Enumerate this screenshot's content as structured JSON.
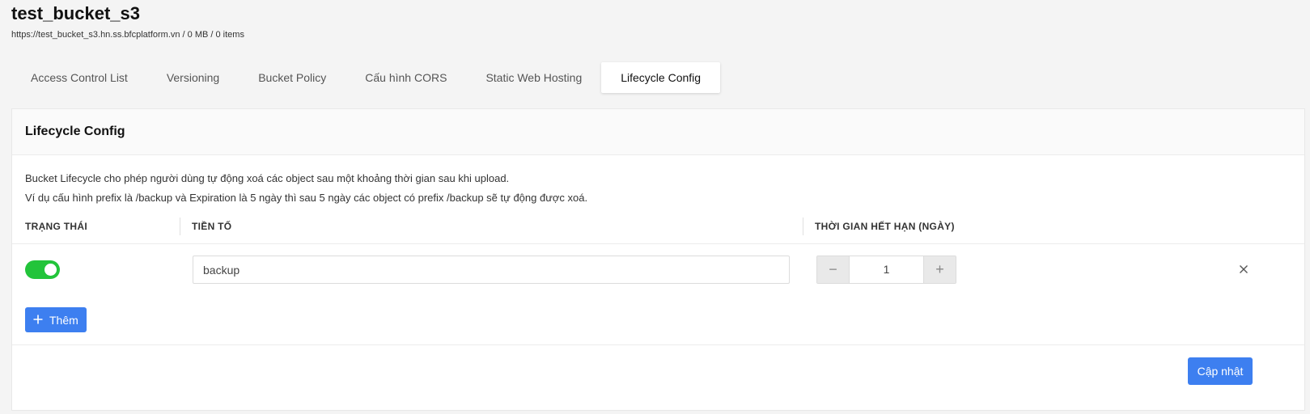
{
  "bucket": {
    "name": "test_bucket_s3",
    "info": "https://test_bucket_s3.hn.ss.bfcplatform.vn / 0 MB / 0 items"
  },
  "tabs": [
    {
      "label": "Access Control List",
      "active": false
    },
    {
      "label": "Versioning",
      "active": false
    },
    {
      "label": "Bucket Policy",
      "active": false
    },
    {
      "label": "Cấu hình CORS",
      "active": false
    },
    {
      "label": "Static Web Hosting",
      "active": false
    },
    {
      "label": "Lifecycle Config",
      "active": true
    }
  ],
  "card": {
    "title": "Lifecycle Config",
    "description_line1": "Bucket Lifecycle cho phép người dùng tự động xoá các object sau một khoảng thời gian sau khi upload.",
    "description_line2": "Ví dụ cấu hình prefix là /backup và Expiration là 5 ngày thì sau 5 ngày các object có prefix /backup sẽ tự động được xoá."
  },
  "table": {
    "columns": [
      "TRẠNG THÁI",
      "TIỀN TỐ",
      "THỜI GIAN HẾT HẠN (NGÀY)"
    ],
    "rows": [
      {
        "enabled": true,
        "prefix": "backup",
        "expiration_days": "1"
      }
    ]
  },
  "buttons": {
    "add_label": "Thêm",
    "update_label": "Cập nhật",
    "decrement": "−",
    "increment": "+"
  },
  "colors": {
    "accent": "#3d7ff0",
    "toggle_on": "#22c43a"
  }
}
